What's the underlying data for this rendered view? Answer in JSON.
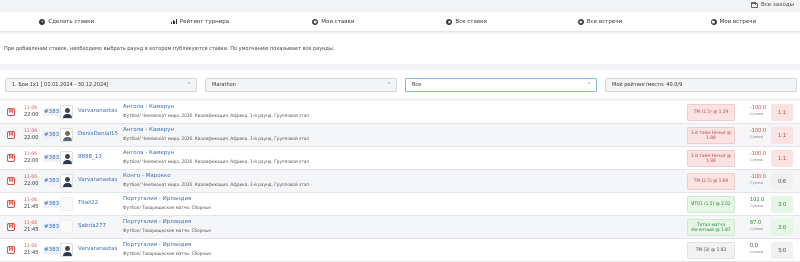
{
  "top": {
    "all_label": "Все заходы"
  },
  "nav": [
    {
      "label": "Сделать ставки",
      "icon": "plus-circle-icon"
    },
    {
      "label": "Рейтинг турнира",
      "icon": "bar-chart-icon"
    },
    {
      "label": "Мои ставки",
      "icon": "user-circle-icon"
    },
    {
      "label": "Все ставки",
      "icon": "eye-icon"
    },
    {
      "label": "Все встречи",
      "icon": "eye-icon"
    },
    {
      "label": "Мои встречи",
      "icon": "user-circle-icon"
    }
  ],
  "info": "При добавлении ставок, необходимо выбрать раунд в котором публикуются ставки. По умолчанию показывает все раунды.",
  "filters": {
    "tournament": "1. Бои 1x1   [ 01.01.2024 - 30.12.2024]",
    "bookmaker": "Marathon",
    "round": "Все",
    "rating": "Мой рейтинг/место: 40.0/9"
  },
  "rows": [
    {
      "date": "11-06",
      "time": "22:00",
      "rid": "#383",
      "user": "Varvaranastas",
      "event": "Ангола - Камерун",
      "sub": "Футбол/ Чемпионат мира. 2026. Квалификация. Африка. 1-й раунд. Групповой этап",
      "bet": "ТМ (1.5) @ 1.29",
      "amount": "-100.0",
      "amount_label": "Сумма",
      "score": "1:1",
      "status": "pending"
    },
    {
      "date": "11-06",
      "time": "22:00",
      "rid": "#383",
      "user": "DenisDenial15",
      "event": "Ангола - Камерун",
      "sub": "Футбол/ Чемпионат мира. 2026. Квалификация. Африка. 1-й раунд. Групповой этап",
      "bet": "1-й тайм Ничья @ 1.88",
      "amount": "-100.0",
      "amount_label": "Сумма",
      "score": "1:1",
      "status": "pending"
    },
    {
      "date": "11-06",
      "time": "22:00",
      "rid": "#383",
      "user": "8888_13",
      "event": "Ангола - Камерун",
      "sub": "Футбол/ Чемпионат мира. 2026. Квалификация. Африка. 1-й раунд. Групповой этап",
      "bet": "1-й тайм Ничья @ 1.88",
      "amount": "-100.0",
      "amount_label": "Сумма",
      "score": "1:1",
      "status": "pending"
    },
    {
      "date": "11-06",
      "time": "22:00",
      "rid": "#383",
      "user": "Varvaranastas",
      "event": "Конго - Марокко",
      "sub": "Футбол/ Чемпионат мира. 2026. Квалификация. Африка. 1-й раунд. Групповой этап",
      "bet": "ТМ (2.5) @ 1.69",
      "amount": "-100.0",
      "amount_label": "Сумма",
      "score": "0:6",
      "status": "pending"
    },
    {
      "date": "11-06",
      "time": "21:45",
      "rid": "#383",
      "user": "Titali22",
      "event": "Португалия - Ирландия",
      "sub": "Футбол/ Товарищеские матчи. Сборные",
      "bet": "ИТ01 (1.5) @ 2.02",
      "amount": "102.0",
      "amount_label": "Сумма",
      "score": "3:0",
      "status": "win"
    },
    {
      "date": "11-06",
      "time": "21:45",
      "rid": "#383",
      "user": "Sabria277",
      "event": "Португалия - Ирландия",
      "sub": "Футбол/ Товарищеские матчи. Сборные",
      "bet": "Тотал матча Нечетный @ 1.87",
      "amount": "87.0",
      "amount_label": "Сумма",
      "score": "3:0",
      "status": "win"
    },
    {
      "date": "11-06",
      "time": "21:45",
      "rid": "#383",
      "user": "Varvaranastas",
      "event": "Португалия - Ирландия",
      "sub": "Футбол/ Товарищеские матчи. Сборные",
      "bet": "ТМ (3) @ 1.83",
      "amount": "0.0",
      "amount_label": "Сумма",
      "score": "3:0",
      "status": "draw"
    }
  ]
}
